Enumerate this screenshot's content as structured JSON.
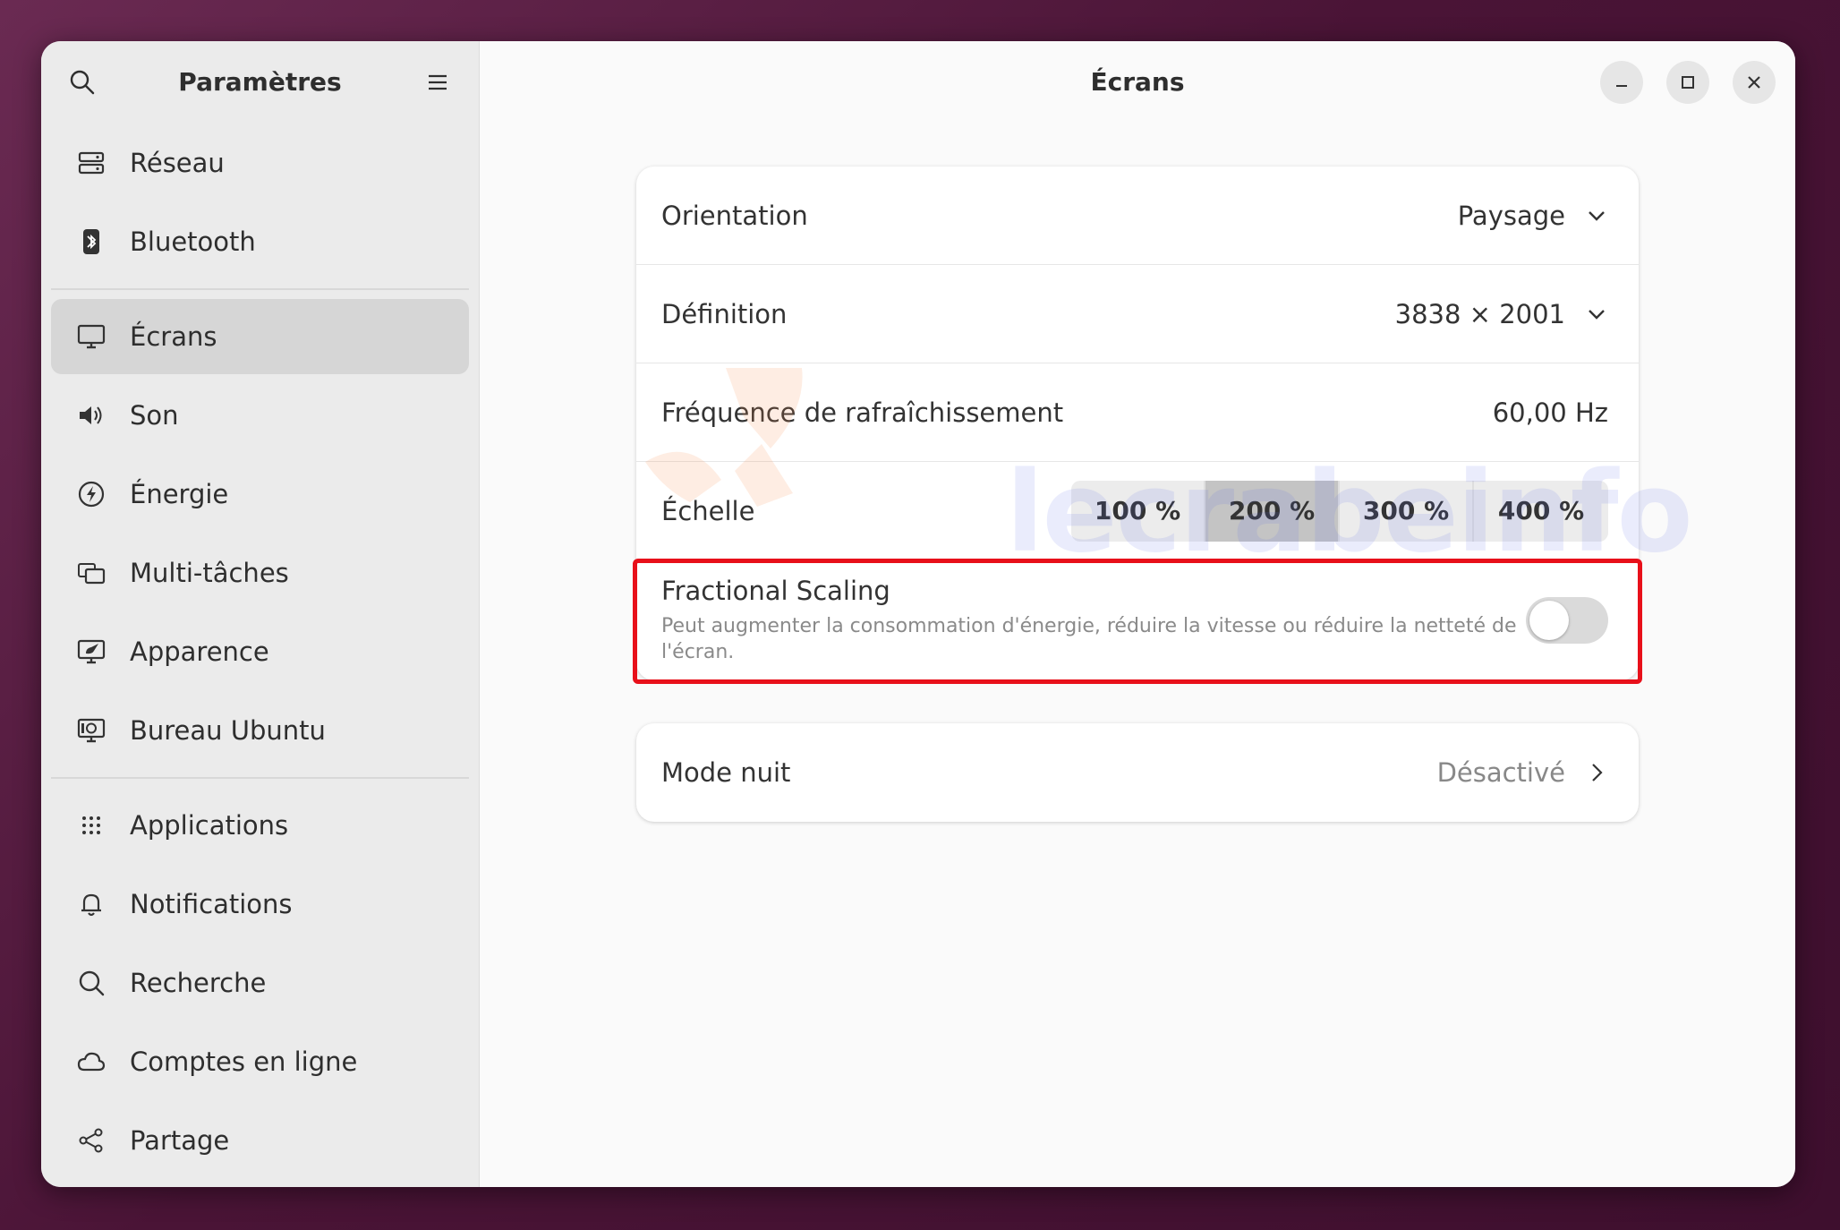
{
  "sidebar": {
    "title": "Paramètres",
    "items": [
      {
        "label": "Réseau",
        "icon": "network-icon"
      },
      {
        "label": "Bluetooth",
        "icon": "bluetooth-icon"
      },
      {
        "label": "Écrans",
        "icon": "display-icon",
        "active": true
      },
      {
        "label": "Son",
        "icon": "speaker-icon"
      },
      {
        "label": "Énergie",
        "icon": "power-icon"
      },
      {
        "label": "Multi-tâches",
        "icon": "multitask-icon"
      },
      {
        "label": "Apparence",
        "icon": "appearance-icon"
      },
      {
        "label": "Bureau Ubuntu",
        "icon": "ubuntu-desktop-icon"
      },
      {
        "label": "Applications",
        "icon": "apps-grid-icon"
      },
      {
        "label": "Notifications",
        "icon": "bell-icon"
      },
      {
        "label": "Recherche",
        "icon": "search-icon"
      },
      {
        "label": "Comptes en ligne",
        "icon": "cloud-icon"
      },
      {
        "label": "Partage",
        "icon": "share-icon"
      }
    ]
  },
  "main": {
    "title": "Écrans",
    "orientation": {
      "label": "Orientation",
      "value": "Paysage"
    },
    "resolution": {
      "label": "Définition",
      "value": "3838 × 2001"
    },
    "refresh": {
      "label": "Fréquence de rafraîchissement",
      "value": "60,00 Hz"
    },
    "scale": {
      "label": "Échelle",
      "options": [
        "100 %",
        "200 %",
        "300 %",
        "400 %"
      ],
      "selected": "200 %"
    },
    "fractional": {
      "title": "Fractional Scaling",
      "subtitle": "Peut augmenter la consommation d'énergie, réduire la vitesse ou réduire la netteté de l'écran.",
      "enabled": false
    },
    "night": {
      "label": "Mode nuit",
      "value": "Désactivé"
    }
  },
  "watermark": "lecrabeinfo",
  "colors": {
    "highlight": "#e8101a",
    "active_item": "#d6d6d6"
  }
}
